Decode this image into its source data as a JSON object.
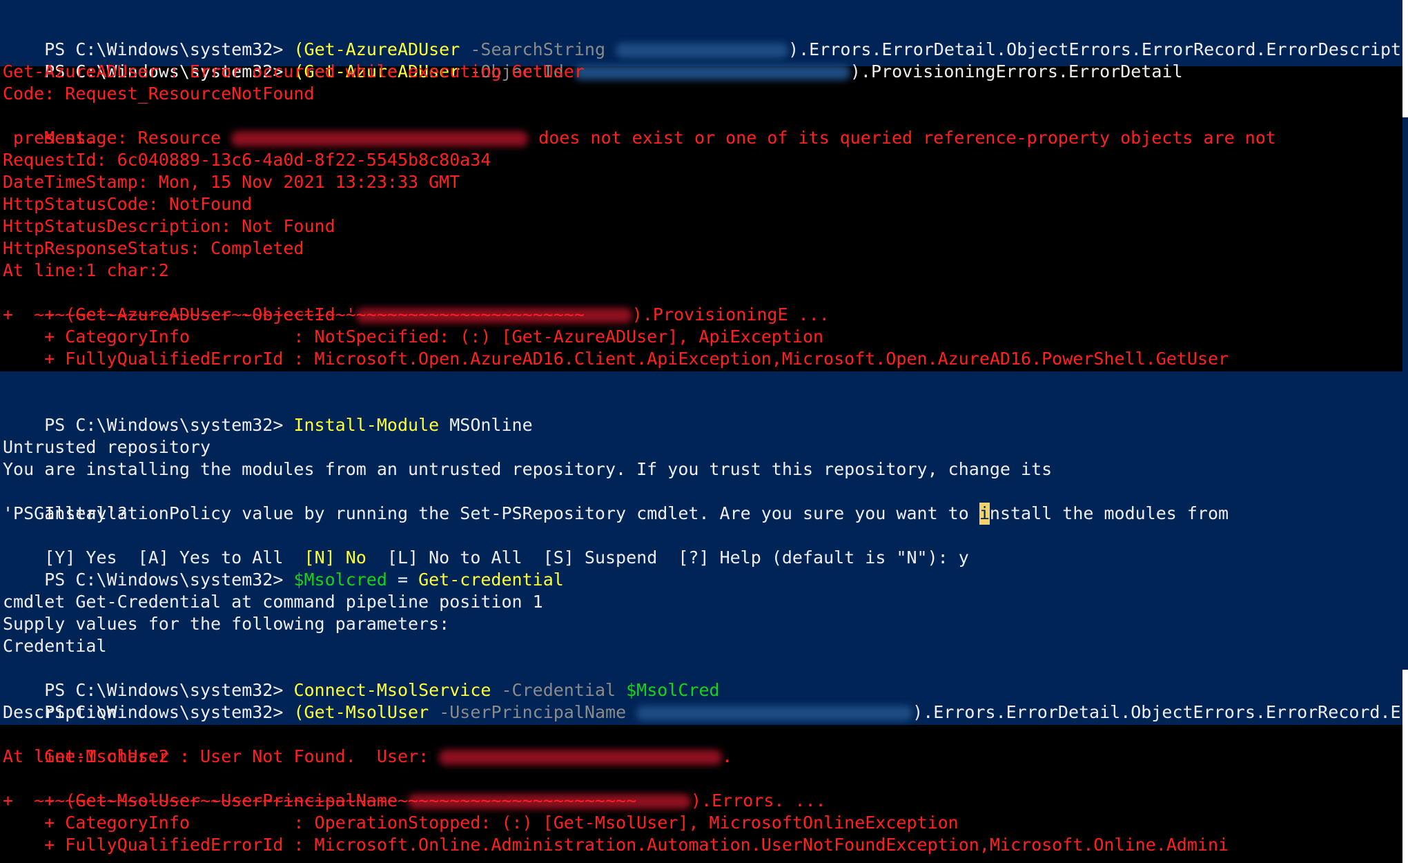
{
  "prompt": "PS C:\\Windows\\system32> ",
  "lines": {
    "l1": {
      "open": "(",
      "cmd": "Get-AzureADUser",
      "param": " -SearchString ",
      "tail": ").Errors.ErrorDetail.ObjectErrors.ErrorRecord.ErrorDescription"
    },
    "l2": {
      "open": "(",
      "cmd": "Get-AzureADUser",
      "param": " -ObjectId ",
      "tail": ").ProvisioningErrors.ErrorDetail"
    },
    "err1": {
      "l3": "Get-AzureADUser : Error occurred while executing GetUser",
      "l4": "Code: Request_ResourceNotFound",
      "l5a": "Message: Resource ",
      "l5b": " does not exist or one of its queried reference-property objects are not",
      "l6": " present.",
      "l7": "RequestId: 6c040889-13c6-4a0d-8f22-5545b8c80a34",
      "l8": "DateTimeStamp: Mon, 15 Nov 2021 13:23:33 GMT",
      "l9": "HttpStatusCode: NotFound",
      "l10": "HttpStatusDescription: Not Found",
      "l11": "HttpResponseStatus: Completed",
      "l12": "At line:1 char:2",
      "l13a": "+ (Get-AzureADUser -ObjectId '",
      "l13b": ").ProvisioningE ...",
      "l14": "+  ~~~~~~~~~~~~~~~~~~~~~~~~~~~~~~~~~~~~~~~~~~~~~~~~~~~~~",
      "l15": "    + CategoryInfo          : NotSpecified: (:) [Get-AzureADUser], ApiException",
      "l16": "    + FullyQualifiedErrorId : Microsoft.Open.AzureAD16.Client.ApiException,Microsoft.Open.AzureAD16.PowerShell.GetUser"
    },
    "l18": {
      "cmd": "Install-Module",
      "arg": " MSOnline"
    },
    "l20": "Untrusted repository",
    "l21": "You are installing the modules from an untrusted repository. If you trust this repository, change its",
    "l22a": "InstallationPolicy value by running the Set-PSRepository cmdlet. Are you sure you want to ",
    "l22cursor": "i",
    "l22b": "nstall the modules from",
    "l23": "'PSGallery'?",
    "l24": {
      "yes": "[Y] Yes  [A] Yes to All  ",
      "no": "[N] No",
      "rest": "  [L] No to All  [S] Suspend  [?] Help (default is \"N\"): y"
    },
    "l25": {
      "var": "$Msolcred",
      "eq": " = ",
      "cmd": "Get-credential"
    },
    "l27": "cmdlet Get-Credential at command pipeline position 1",
    "l28": "Supply values for the following parameters:",
    "l29": "Credential",
    "l30": {
      "cmd": "Connect-MsolService",
      "param": " -Credential ",
      "var": "$MsolCred"
    },
    "l31": {
      "open": "(",
      "cmd": "Get-MsolUser",
      "param": " -UserPrincipalName ",
      "tail": ").Errors.ErrorDetail.ObjectErrors.ErrorRecord.Error"
    },
    "l32": "Description",
    "err2": {
      "l33a": "Get-MsolUser : User Not Found.  User: ",
      "l33b": ".",
      "l34": "At line:1 char:2",
      "l35a": "+ (Get-MsolUser -UserPrincipalName ",
      "l35b": ").Errors. ...",
      "l36": "+  ~~~~~~~~~~~~~~~~~~~~~~~~~~~~~~~~~~~~~~~~~~~~~~~~~~~~~~~~~~",
      "l37": "    + CategoryInfo          : OperationStopped: (:) [Get-MsolUser], MicrosoftOnlineException",
      "l38": "    + FullyQualifiedErrorId : Microsoft.Online.Administration.Automation.UserNotFoundException,Microsoft.Online.Admini"
    }
  },
  "colors": {
    "background": "#012456",
    "selection_bg": "#000000",
    "error": "#ff2121",
    "command": "#ffff38",
    "parameter": "#8a8a8a",
    "variable": "#16d317",
    "text": "#eeedf0"
  }
}
